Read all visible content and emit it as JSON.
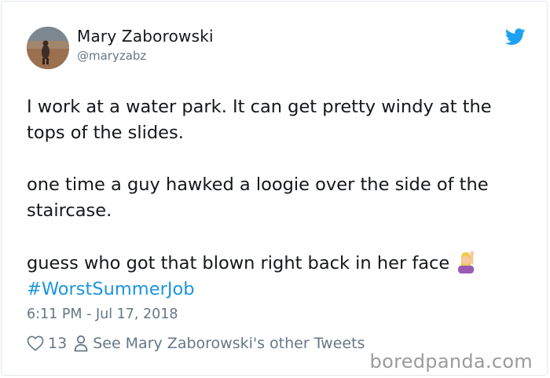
{
  "author": {
    "name": "Mary Zaborowski",
    "handle": "@maryzabz"
  },
  "tweet": {
    "paragraphs": [
      "I work at a water park. It can get pretty windy at the tops of the slides.",
      "one time a guy hawked a loogie over the side of the staircase.",
      "guess who got that blown right back in her face"
    ],
    "emoji": "woman-raising-hand-emoji",
    "hashtag": "#WorstSummerJob",
    "timestamp": "6:11 PM - Jul 17, 2018"
  },
  "actions": {
    "likes": "13",
    "see_more": "See Mary Zaborowski's other Tweets"
  },
  "watermark": "boredpanda.com",
  "colors": {
    "twitter_blue": "#1da1f2",
    "hashtag": "#1b95e0",
    "secondary_text": "#657786"
  }
}
